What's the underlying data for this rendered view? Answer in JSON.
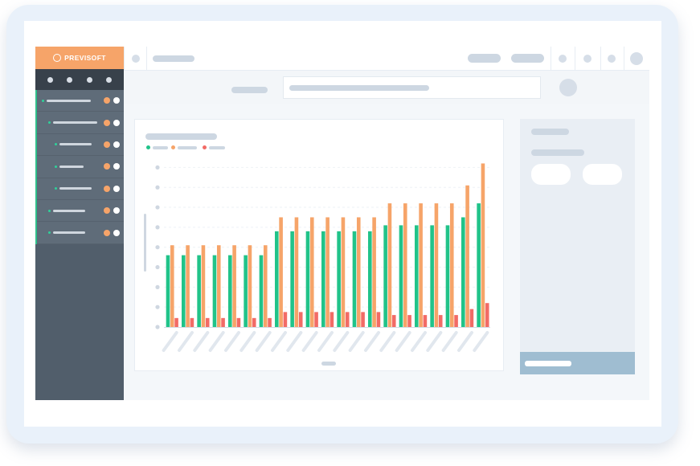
{
  "brand": {
    "name": "PREVISOFT",
    "logo_color": "#f6a469"
  },
  "colors": {
    "green": "#21c389",
    "orange": "#f6a469",
    "red": "#f26b66"
  },
  "sidebar": {
    "items": [
      {
        "name": "sidebar-item-1",
        "indent": 0,
        "bar": 55
      },
      {
        "name": "sidebar-item-2",
        "indent": 8,
        "bar": 55
      },
      {
        "name": "sidebar-item-3",
        "indent": 16,
        "bar": 40
      },
      {
        "name": "sidebar-item-4",
        "indent": 16,
        "bar": 30
      },
      {
        "name": "sidebar-item-5",
        "indent": 16,
        "bar": 40
      },
      {
        "name": "sidebar-item-6",
        "indent": 8,
        "bar": 40
      },
      {
        "name": "sidebar-item-7",
        "indent": 8,
        "bar": 40
      }
    ]
  },
  "chart_data": {
    "type": "bar",
    "categories": [
      "",
      "",
      "",
      "",
      "",
      "",
      "",
      "",
      "",
      "",
      "",
      "",
      "",
      "",
      "",
      "",
      "",
      "",
      "",
      "",
      ""
    ],
    "ylim": [
      0,
      8.5
    ],
    "grid": true,
    "series": [
      {
        "color": "#21c389",
        "values": [
          3.6,
          3.6,
          3.6,
          3.6,
          3.6,
          3.6,
          3.6,
          4.8,
          4.8,
          4.8,
          4.8,
          4.8,
          4.8,
          4.8,
          5.1,
          5.1,
          5.1,
          5.1,
          5.1,
          5.5,
          6.2
        ]
      },
      {
        "color": "#f6a469",
        "values": [
          4.1,
          4.1,
          4.1,
          4.1,
          4.1,
          4.1,
          4.1,
          5.5,
          5.5,
          5.5,
          5.5,
          5.5,
          5.5,
          5.5,
          6.2,
          6.2,
          6.2,
          6.2,
          6.2,
          7.1,
          8.2
        ]
      },
      {
        "color": "#f26b66",
        "values": [
          0.45,
          0.45,
          0.45,
          0.45,
          0.45,
          0.45,
          0.45,
          0.75,
          0.75,
          0.75,
          0.75,
          0.75,
          0.75,
          0.75,
          0.6,
          0.6,
          0.6,
          0.6,
          0.6,
          0.9,
          1.2
        ]
      }
    ]
  }
}
